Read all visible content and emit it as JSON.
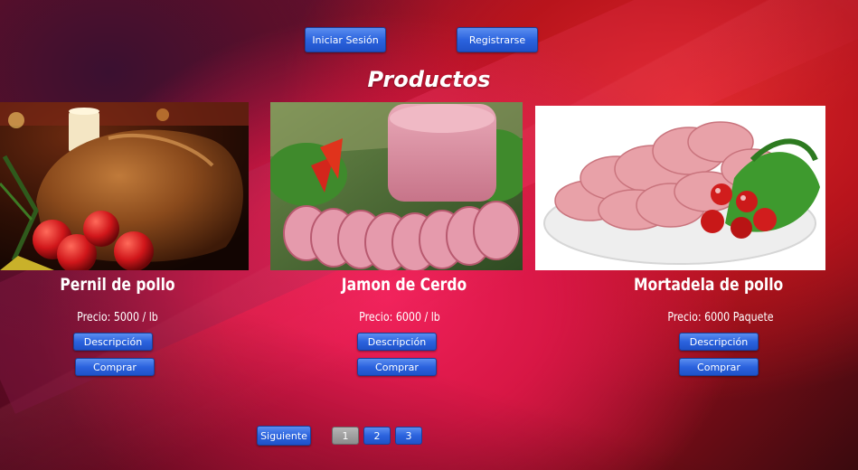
{
  "header": {
    "login_label": "Iniciar Sesión",
    "register_label": "Registrarse"
  },
  "page_title": "Productos",
  "products": [
    {
      "name": "Pernil de pollo",
      "price": "Precio: 5000 / lb",
      "description_label": "Descripción",
      "buy_label": "Comprar",
      "image": "roast-chicken-image"
    },
    {
      "name": "Jamon de Cerdo",
      "price": "Precio: 6000 / lb",
      "description_label": "Descripción",
      "buy_label": "Comprar",
      "image": "pork-ham-image"
    },
    {
      "name": "Mortadela de pollo",
      "price": "Precio: 6000 Paquete",
      "description_label": "Descripción",
      "buy_label": "Comprar",
      "image": "mortadella-plate-image"
    }
  ],
  "pagination": {
    "next_label": "Siguiente",
    "pages": [
      "1",
      "2",
      "3"
    ],
    "current_page": "1"
  },
  "colors": {
    "button_blue": "#2b63de",
    "button_border": "#1a3f9a",
    "current_page_gray": "#9a9a9a",
    "background_red": "#d81745"
  }
}
